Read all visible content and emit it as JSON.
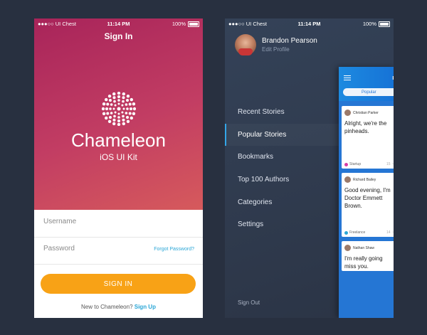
{
  "status": {
    "carrier": "●●●○○ UI Chest",
    "time": "11:14 PM",
    "battery": "100%"
  },
  "signin": {
    "title": "Sign In",
    "brand": "Chameleon",
    "kit": "iOS UI Kit",
    "username_placeholder": "Username",
    "password_placeholder": "Password",
    "forgot": "Forgot Password?",
    "button": "SIGN IN",
    "new_text": "New to Chameleon?",
    "signup": "Sign Up"
  },
  "menu": {
    "user_name": "Brandon Pearson",
    "edit_profile": "Edit Profile",
    "items": [
      {
        "label": "Recent Stories"
      },
      {
        "label": "Popular Stories"
      },
      {
        "label": "Bookmarks"
      },
      {
        "label": "Top 100 Authors"
      },
      {
        "label": "Categories"
      },
      {
        "label": "Settings"
      }
    ],
    "active_index": 1,
    "sign_out": "Sign Out"
  },
  "preview": {
    "title": "P",
    "tab": "Popular",
    "cards": [
      {
        "author": "Christian Parker",
        "text": "Alright, we're the pinheads.",
        "tag": "Startup",
        "tag_color": "#d63da6",
        "meta": "15 ◔"
      },
      {
        "author": "Richard Bailey",
        "text": "Good evening, I'm Doctor Emmett Brown.",
        "tag": "Freelance",
        "tag_color": "#2aa6d6",
        "meta": "14 ◔"
      },
      {
        "author": "Nathan Shaw",
        "text": "I'm really going miss you.",
        "tag": "",
        "tag_color": "#999999",
        "meta": ""
      }
    ]
  },
  "colors": {
    "accent": "#f8a216",
    "link": "#2aa6d6",
    "active_bar": "#33a6e8"
  }
}
